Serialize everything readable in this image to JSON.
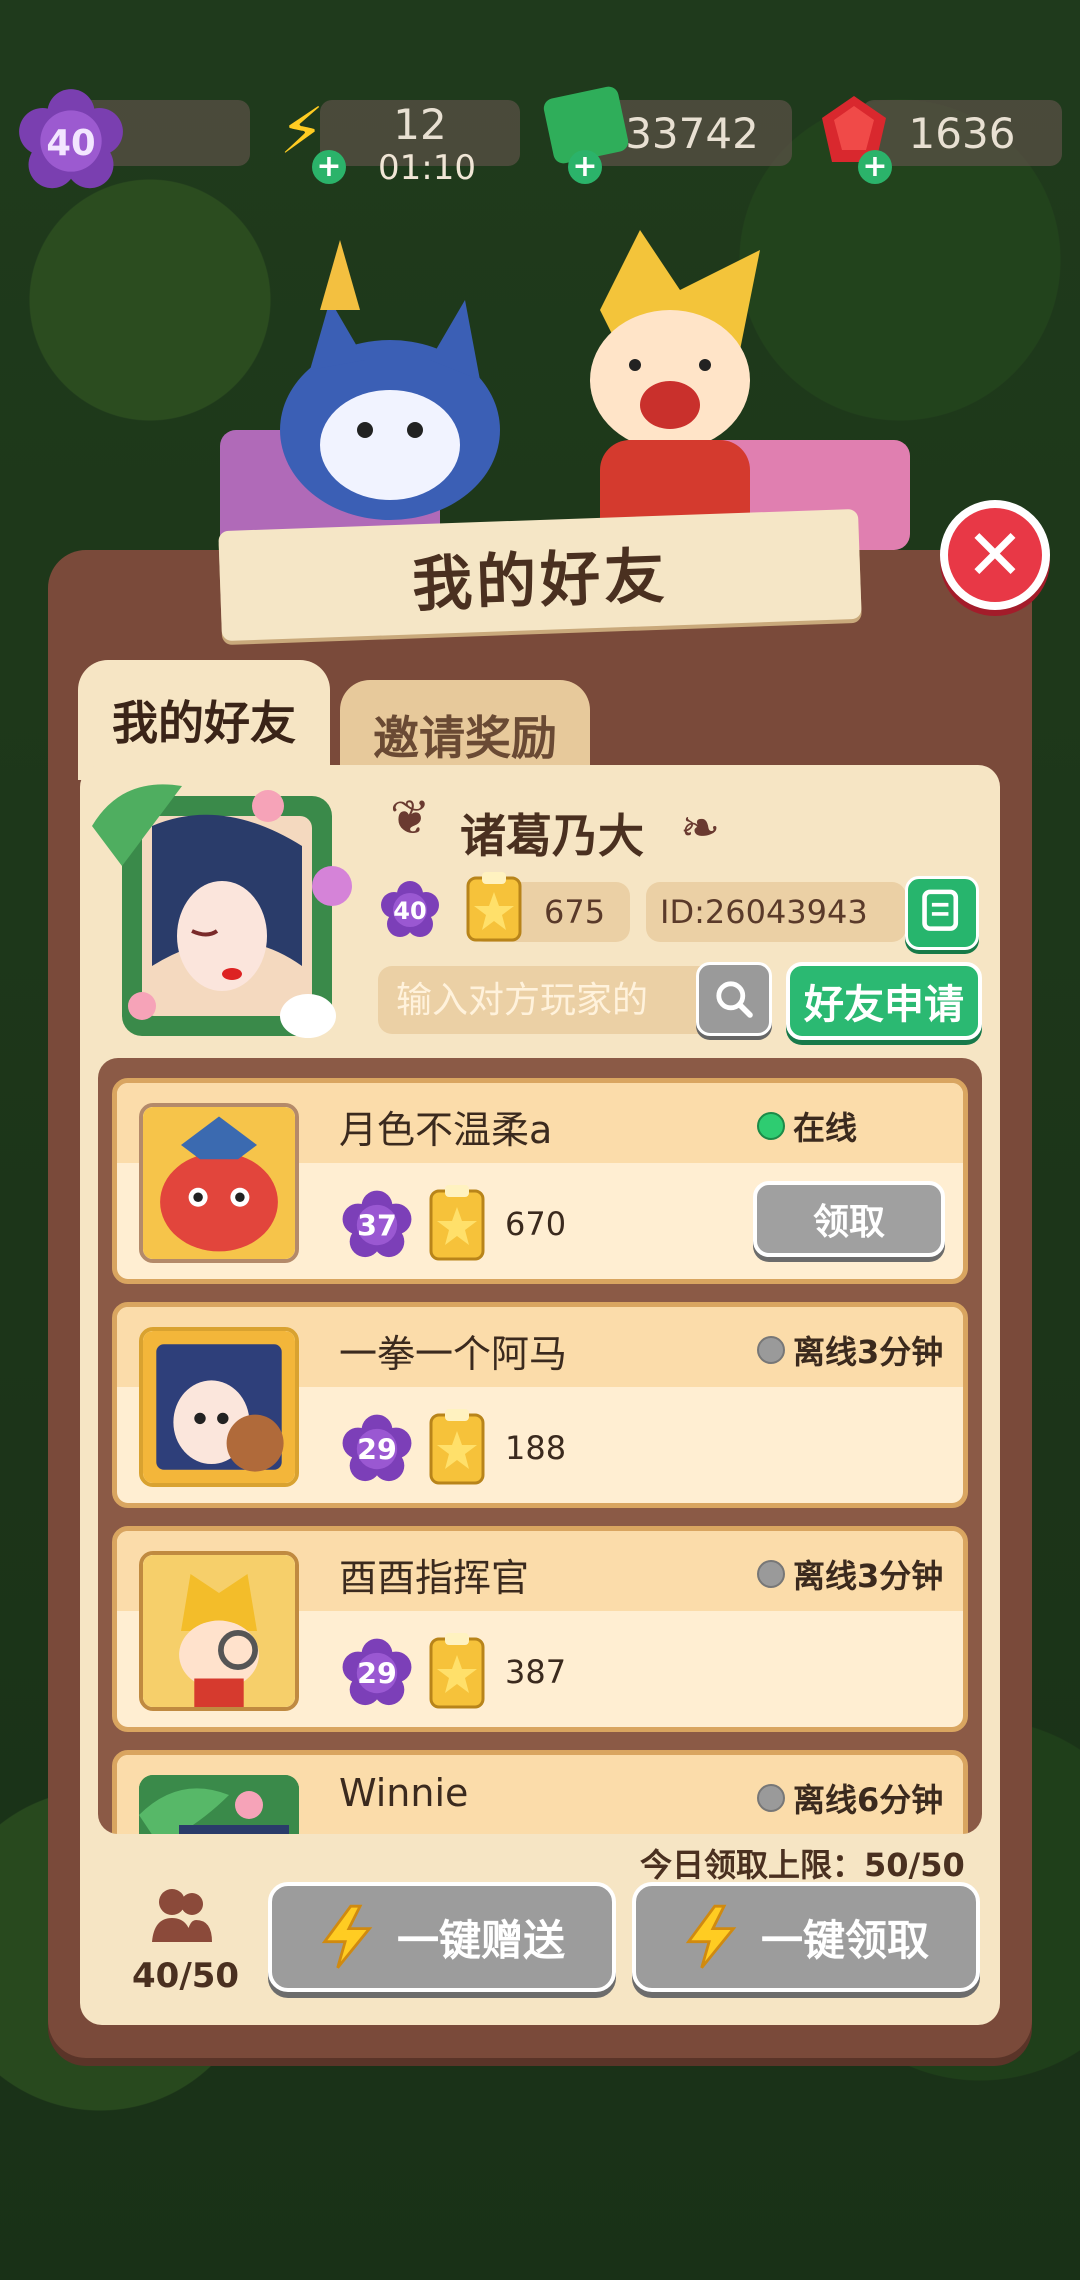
{
  "resources": {
    "level": "40",
    "energy": "12",
    "energy_timer": "01:10",
    "cash": "33742",
    "gems": "1636"
  },
  "dialog": {
    "title": "我的好友",
    "tabs": [
      "我的好友",
      "邀请奖励"
    ]
  },
  "player": {
    "name": "诸葛乃大",
    "level": "40",
    "score": "675",
    "id_text": "ID:26043943"
  },
  "search": {
    "placeholder": "输入对方玩家的",
    "request_label": "好友申请"
  },
  "friends": [
    {
      "name": "月色不温柔a",
      "status": "在线",
      "online": true,
      "level": "37",
      "score": "670",
      "action": "领取"
    },
    {
      "name": "一拳一个阿马",
      "status": "离线3分钟",
      "online": false,
      "level": "29",
      "score": "188"
    },
    {
      "name": "酉酉指挥官",
      "status": "离线3分钟",
      "online": false,
      "level": "29",
      "score": "387"
    },
    {
      "name": "Winnie",
      "status": "离线6分钟",
      "online": false
    }
  ],
  "footer": {
    "limit_text": "今日领取上限：50/50",
    "friend_count": "40/50",
    "send_all": "一键赠送",
    "claim_all": "一键领取"
  },
  "colors": {
    "panel_brown": "#7a4a3a",
    "panel_cream": "#f6e5c4",
    "green_button": "#2bb972",
    "close_red": "#e83846",
    "online_green": "#2ecc71"
  }
}
